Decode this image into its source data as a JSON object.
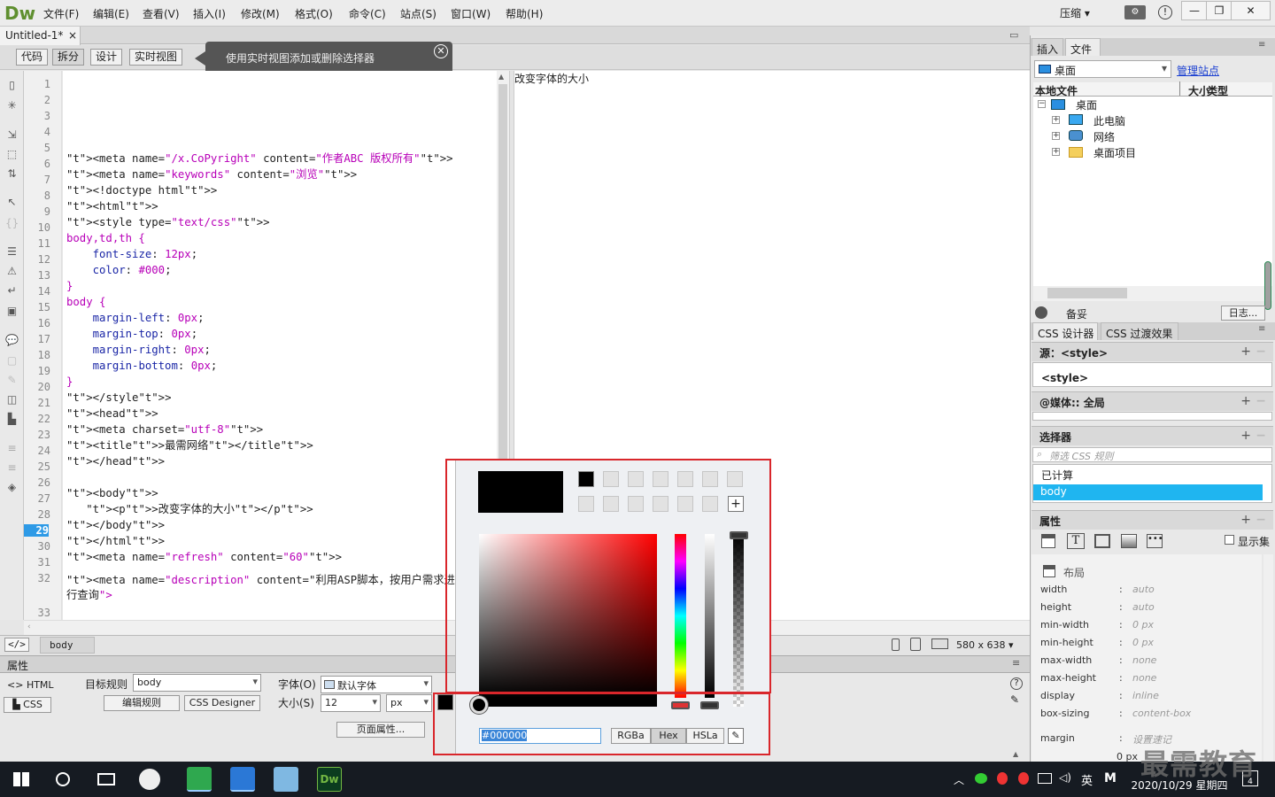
{
  "app": {
    "logo": "Dw",
    "menu": [
      "文件(F)",
      "编辑(E)",
      "查看(V)",
      "插入(I)",
      "修改(M)",
      "格式(O)",
      "命令(C)",
      "站点(S)",
      "窗口(W)",
      "帮助(H)"
    ],
    "workspace": "压缩",
    "window_buttons": [
      "—",
      "❐",
      "✕"
    ]
  },
  "document": {
    "tab_title": "Untitled-1*",
    "views": [
      "代码",
      "拆分",
      "设计",
      "实时视图"
    ],
    "tooltip": "使用实时视图添加或删除选择器",
    "current_line": 29,
    "code_lines": [
      "",
      "",
      "",
      "",
      "",
      "<meta name=\"/x.CoPyright\" content=\"作者ABC 版权所有\">",
      "<meta name=\"keywords\" content=\"浏览\">",
      "<!doctype html>",
      "<html>",
      "<style type=\"text/css\">",
      "body,td,th {",
      "    font-size: 12px;",
      "    color: #000;",
      "}",
      "body {",
      "    margin-left: 0px;",
      "    margin-top: 0px;",
      "    margin-right: 0px;",
      "    margin-bottom: 0px;",
      "}",
      "</style>",
      "<head>",
      "<meta charset=\"utf-8\">",
      "<title>最需网络</title>",
      "</head>",
      "",
      "<body>",
      "   <p>改变字体的大小</p>",
      "</body>",
      "</html>",
      "<meta name=\"refresh\" content=\"60\">",
      "<meta name=\"description\" content=\"利用ASP脚本，按用户需求进",
      "行查询\">",
      ""
    ],
    "live_text": "改变字体的大小"
  },
  "statusbar": {
    "tag_icon": "</>",
    "tag": "body",
    "window_size": "580 x 638"
  },
  "properties": {
    "title": "属性",
    "html_label": "HTML",
    "css_label": "CSS",
    "target_rule_label": "目标规则",
    "target_rule_value": "body",
    "edit_rule": "编辑规则",
    "css_designer": "CSS Designer",
    "font_label": "字体(O)",
    "font_value": "默认字体",
    "size_label": "大小(S)",
    "size_value": "12",
    "size_unit": "px",
    "page_props": "页面属性..."
  },
  "color_picker": {
    "color": "#000000",
    "hex_value": "#000000",
    "modes": [
      "RGBa",
      "Hex",
      "HSLa"
    ],
    "active_mode": "Hex",
    "add_swatch": "+"
  },
  "files_panel": {
    "tabs": [
      "插入",
      "文件"
    ],
    "active_tab": "文件",
    "site": "桌面",
    "manage_site": "管理站点",
    "col_local": "本地文件",
    "col_size": "大小",
    "col_type": "类型",
    "tree": [
      {
        "label": "桌面",
        "level": 0,
        "expander": "−"
      },
      {
        "label": "此电脑",
        "level": 1,
        "expander": "+"
      },
      {
        "label": "网络",
        "level": 1,
        "expander": "+"
      },
      {
        "label": "桌面项目",
        "level": 1,
        "expander": "+"
      }
    ],
    "status": "备妥",
    "log_button": "日志..."
  },
  "css_designer": {
    "tabs": [
      "CSS 设计器",
      "CSS 过渡效果"
    ],
    "source_label": "源：<style>",
    "source_item": "<style>",
    "media_label": "@媒体:: 全局",
    "selectors_label": "选择器",
    "filter_placeholder": "筛选 CSS 规则",
    "computed": "已计算",
    "selected": "body",
    "properties_label": "属性",
    "show_set": "显示集",
    "layout_label": "布局",
    "props": [
      {
        "name": "width",
        "value": "auto"
      },
      {
        "name": "height",
        "value": "auto"
      },
      {
        "name": "min-width",
        "value": "0 px"
      },
      {
        "name": "min-height",
        "value": "0 px"
      },
      {
        "name": "max-width",
        "value": "none"
      },
      {
        "name": "max-height",
        "value": "none"
      },
      {
        "name": "display",
        "value": "inline"
      },
      {
        "name": "box-sizing",
        "value": "content-box"
      }
    ],
    "margin_label": "margin",
    "margin_value": "设置速记",
    "margin_zero": "0 px"
  },
  "taskbar": {
    "ime": "英",
    "time_line": "2020/10/29 星期四",
    "notif_count": "4"
  },
  "watermark": "最需教育"
}
